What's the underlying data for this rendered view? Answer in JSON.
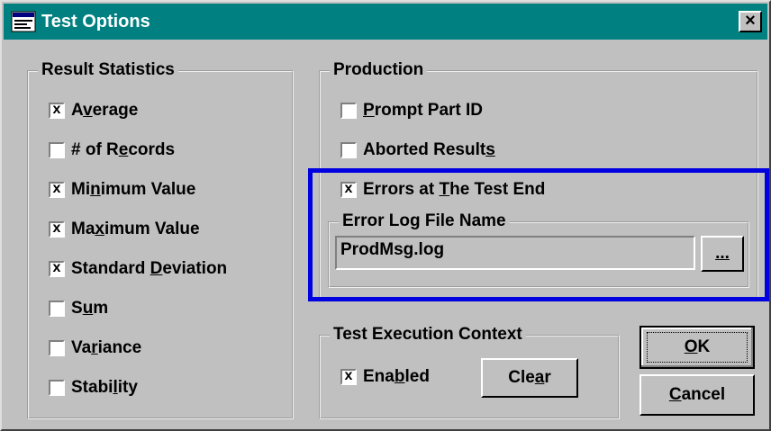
{
  "window": {
    "title": "Test Options",
    "icon": "dialog-app-icon",
    "close_label": "×"
  },
  "result_statistics": {
    "legend": "Result Statistics",
    "items": [
      {
        "pre": "A",
        "u": "v",
        "post": "erage",
        "checked": true
      },
      {
        "pre": "# of R",
        "u": "e",
        "post": "cords",
        "checked": false
      },
      {
        "pre": "Mi",
        "u": "n",
        "post": "imum Value",
        "checked": true
      },
      {
        "pre": "Ma",
        "u": "x",
        "post": "imum Value",
        "checked": true
      },
      {
        "pre": "Standard ",
        "u": "D",
        "post": "eviation",
        "checked": true
      },
      {
        "pre": "S",
        "u": "u",
        "post": "m",
        "checked": false
      },
      {
        "pre": "Va",
        "u": "r",
        "post": "iance",
        "checked": false
      },
      {
        "pre": "Stabi",
        "u": "l",
        "post": "ity",
        "checked": false
      }
    ]
  },
  "production": {
    "legend": "Production",
    "items": [
      {
        "pre": "",
        "u": "P",
        "post": "rompt Part ID",
        "checked": false
      },
      {
        "pre": "Aborted Result",
        "u": "s",
        "post": "",
        "checked": false
      },
      {
        "pre": "Errors at ",
        "u": "T",
        "post": "he Test End",
        "checked": true
      }
    ],
    "error_log": {
      "legend": "Error Log File Name",
      "value": "ProdMsg.log",
      "browse_label": "..."
    }
  },
  "context": {
    "legend": "Test Execution Context",
    "enabled": {
      "pre": "Ena",
      "u": "b",
      "post": "led",
      "checked": true
    },
    "clear": {
      "pre": "Cle",
      "u": "a",
      "post": "r"
    }
  },
  "buttons": {
    "ok": {
      "pre": "",
      "u": "O",
      "post": "K"
    },
    "cancel": {
      "pre": "",
      "u": "C",
      "post": "ancel"
    }
  },
  "colors": {
    "titlebar": "#008080",
    "face": "#c0c0c0",
    "highlight": "#0000e0"
  }
}
